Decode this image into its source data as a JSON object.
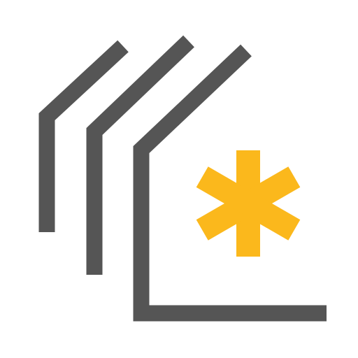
{
  "logo": {
    "name": "house-asterisk-logo",
    "colors": {
      "background": "#ffffff",
      "outline": "#555555",
      "asterisk": "#fbb81c"
    },
    "icon": "house-outline-with-asterisk"
  }
}
